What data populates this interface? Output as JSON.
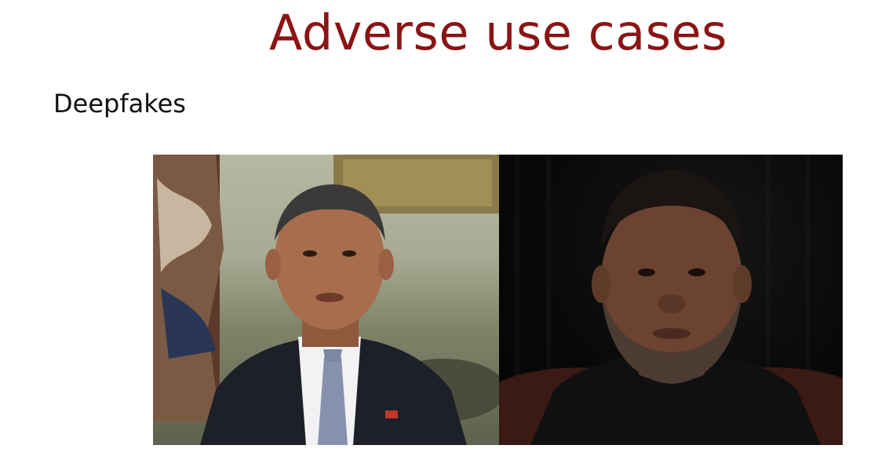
{
  "slide": {
    "title": "Adverse use cases",
    "subtitle": "Deepfakes"
  },
  "colors": {
    "title": "#8b1414",
    "text": "#111111",
    "background": "#ffffff"
  },
  "video": {
    "panels": [
      {
        "name": "left-video-panel"
      },
      {
        "name": "right-video-panel"
      }
    ]
  }
}
